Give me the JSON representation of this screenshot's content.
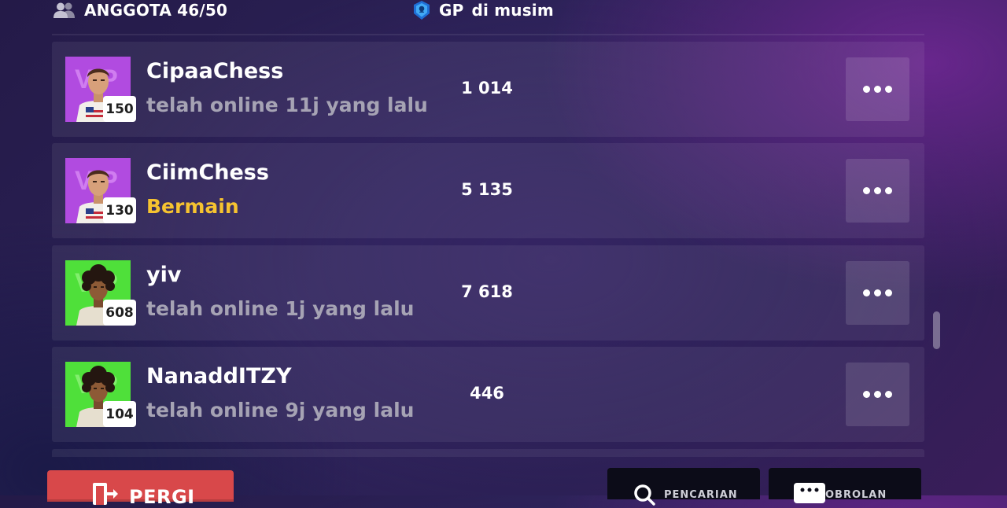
{
  "header": {
    "members_label": "ANGGOTA 46/50",
    "gp_label": "GP",
    "season_label": "di musim",
    "icons": {
      "members": "people-icon",
      "gp": "gp-shield-icon"
    }
  },
  "members": [
    {
      "name": "CipaaChess",
      "level": "150",
      "status": "telah online 11j yang lalu",
      "status_type": "offline",
      "gp": "1 014",
      "avatar": "purple",
      "more_icon": "more-dots-icon"
    },
    {
      "name": "CiimChess",
      "level": "130",
      "status": "Bermain",
      "status_type": "playing",
      "gp": "5 135",
      "avatar": "purple",
      "more_icon": "more-dots-icon"
    },
    {
      "name": "yiv",
      "level": "608",
      "status": "telah online 1j yang lalu",
      "status_type": "offline",
      "gp": "7 618",
      "avatar": "green",
      "more_icon": "more-dots-icon"
    },
    {
      "name": "NanaddITZY",
      "level": "104",
      "status": "telah online 9j yang lalu",
      "status_type": "offline",
      "gp": "446",
      "avatar": "green",
      "more_icon": "more-dots-icon"
    }
  ],
  "footer": {
    "leave_label": "PERGI",
    "search_label": "PENCARIAN",
    "chat_label": "OBROLAN",
    "icons": {
      "leave": "exit-door-icon",
      "search": "search-icon",
      "chat": "chat-icon"
    }
  },
  "colors": {
    "status_playing": "#f6c330",
    "status_offline": "#a6a3b4",
    "leave_button": "#d8484a",
    "avatar_purple": "#b14be0",
    "avatar_green": "#4fe03a"
  }
}
